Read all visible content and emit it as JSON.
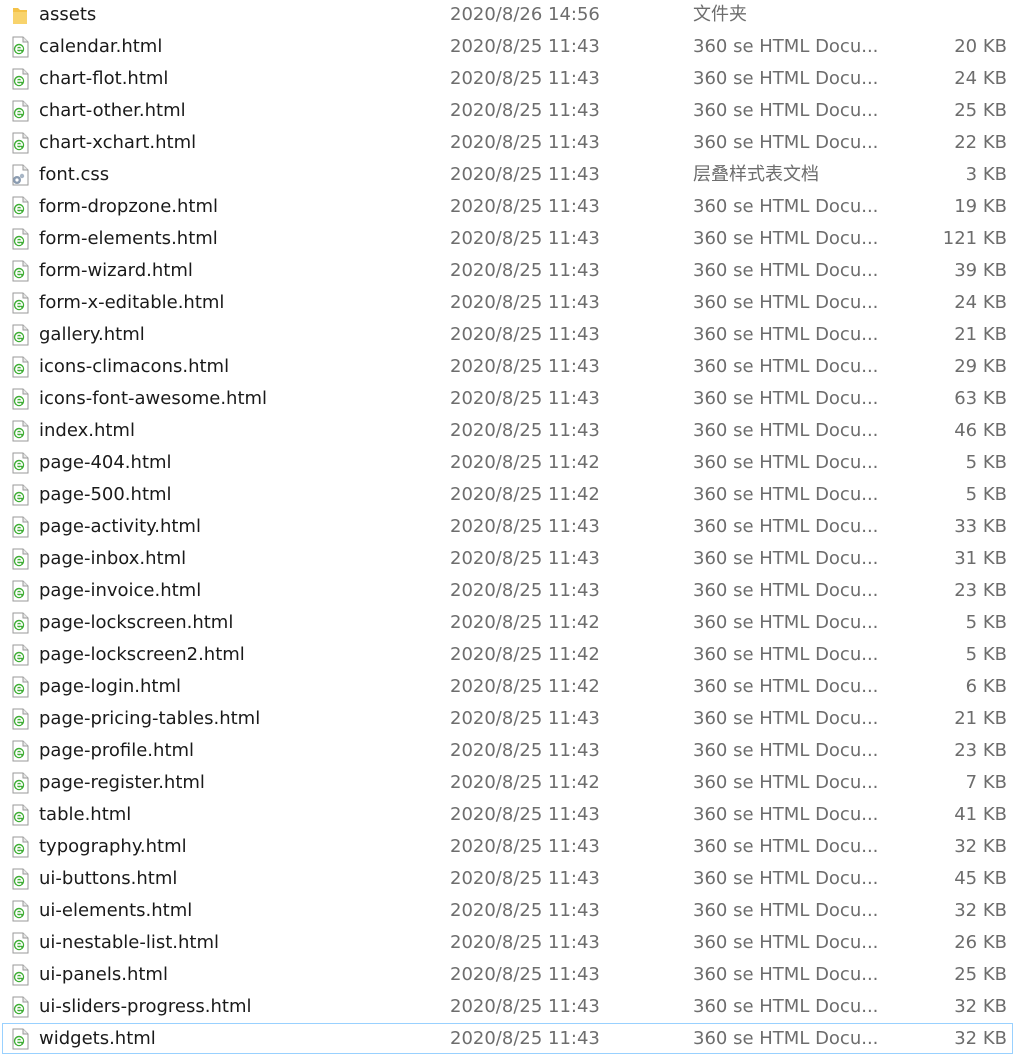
{
  "files": [
    {
      "name": "assets",
      "date": "2020/8/26 14:56",
      "type": "文件夹",
      "size": "",
      "icon": "folder-icon"
    },
    {
      "name": "calendar.html",
      "date": "2020/8/25 11:43",
      "type": "360 se HTML Docu...",
      "size": "20 KB",
      "icon": "html-file-icon"
    },
    {
      "name": "chart-flot.html",
      "date": "2020/8/25 11:43",
      "type": "360 se HTML Docu...",
      "size": "24 KB",
      "icon": "html-file-icon"
    },
    {
      "name": "chart-other.html",
      "date": "2020/8/25 11:43",
      "type": "360 se HTML Docu...",
      "size": "25 KB",
      "icon": "html-file-icon"
    },
    {
      "name": "chart-xchart.html",
      "date": "2020/8/25 11:43",
      "type": "360 se HTML Docu...",
      "size": "22 KB",
      "icon": "html-file-icon"
    },
    {
      "name": "font.css",
      "date": "2020/8/25 11:43",
      "type": "层叠样式表文档",
      "size": "3 KB",
      "icon": "css-file-icon"
    },
    {
      "name": "form-dropzone.html",
      "date": "2020/8/25 11:43",
      "type": "360 se HTML Docu...",
      "size": "19 KB",
      "icon": "html-file-icon"
    },
    {
      "name": "form-elements.html",
      "date": "2020/8/25 11:43",
      "type": "360 se HTML Docu...",
      "size": "121 KB",
      "icon": "html-file-icon"
    },
    {
      "name": "form-wizard.html",
      "date": "2020/8/25 11:43",
      "type": "360 se HTML Docu...",
      "size": "39 KB",
      "icon": "html-file-icon"
    },
    {
      "name": "form-x-editable.html",
      "date": "2020/8/25 11:43",
      "type": "360 se HTML Docu...",
      "size": "24 KB",
      "icon": "html-file-icon"
    },
    {
      "name": "gallery.html",
      "date": "2020/8/25 11:43",
      "type": "360 se HTML Docu...",
      "size": "21 KB",
      "icon": "html-file-icon"
    },
    {
      "name": "icons-climacons.html",
      "date": "2020/8/25 11:43",
      "type": "360 se HTML Docu...",
      "size": "29 KB",
      "icon": "html-file-icon"
    },
    {
      "name": "icons-font-awesome.html",
      "date": "2020/8/25 11:43",
      "type": "360 se HTML Docu...",
      "size": "63 KB",
      "icon": "html-file-icon"
    },
    {
      "name": "index.html",
      "date": "2020/8/25 11:43",
      "type": "360 se HTML Docu...",
      "size": "46 KB",
      "icon": "html-file-icon"
    },
    {
      "name": "page-404.html",
      "date": "2020/8/25 11:42",
      "type": "360 se HTML Docu...",
      "size": "5 KB",
      "icon": "html-file-icon"
    },
    {
      "name": "page-500.html",
      "date": "2020/8/25 11:42",
      "type": "360 se HTML Docu...",
      "size": "5 KB",
      "icon": "html-file-icon"
    },
    {
      "name": "page-activity.html",
      "date": "2020/8/25 11:43",
      "type": "360 se HTML Docu...",
      "size": "33 KB",
      "icon": "html-file-icon"
    },
    {
      "name": "page-inbox.html",
      "date": "2020/8/25 11:43",
      "type": "360 se HTML Docu...",
      "size": "31 KB",
      "icon": "html-file-icon"
    },
    {
      "name": "page-invoice.html",
      "date": "2020/8/25 11:43",
      "type": "360 se HTML Docu...",
      "size": "23 KB",
      "icon": "html-file-icon"
    },
    {
      "name": "page-lockscreen.html",
      "date": "2020/8/25 11:42",
      "type": "360 se HTML Docu...",
      "size": "5 KB",
      "icon": "html-file-icon"
    },
    {
      "name": "page-lockscreen2.html",
      "date": "2020/8/25 11:42",
      "type": "360 se HTML Docu...",
      "size": "5 KB",
      "icon": "html-file-icon"
    },
    {
      "name": "page-login.html",
      "date": "2020/8/25 11:42",
      "type": "360 se HTML Docu...",
      "size": "6 KB",
      "icon": "html-file-icon"
    },
    {
      "name": "page-pricing-tables.html",
      "date": "2020/8/25 11:43",
      "type": "360 se HTML Docu...",
      "size": "21 KB",
      "icon": "html-file-icon"
    },
    {
      "name": "page-profile.html",
      "date": "2020/8/25 11:43",
      "type": "360 se HTML Docu...",
      "size": "23 KB",
      "icon": "html-file-icon"
    },
    {
      "name": "page-register.html",
      "date": "2020/8/25 11:42",
      "type": "360 se HTML Docu...",
      "size": "7 KB",
      "icon": "html-file-icon"
    },
    {
      "name": "table.html",
      "date": "2020/8/25 11:43",
      "type": "360 se HTML Docu...",
      "size": "41 KB",
      "icon": "html-file-icon"
    },
    {
      "name": "typography.html",
      "date": "2020/8/25 11:43",
      "type": "360 se HTML Docu...",
      "size": "32 KB",
      "icon": "html-file-icon"
    },
    {
      "name": "ui-buttons.html",
      "date": "2020/8/25 11:43",
      "type": "360 se HTML Docu...",
      "size": "45 KB",
      "icon": "html-file-icon"
    },
    {
      "name": "ui-elements.html",
      "date": "2020/8/25 11:43",
      "type": "360 se HTML Docu...",
      "size": "32 KB",
      "icon": "html-file-icon"
    },
    {
      "name": "ui-nestable-list.html",
      "date": "2020/8/25 11:43",
      "type": "360 se HTML Docu...",
      "size": "26 KB",
      "icon": "html-file-icon"
    },
    {
      "name": "ui-panels.html",
      "date": "2020/8/25 11:43",
      "type": "360 se HTML Docu...",
      "size": "25 KB",
      "icon": "html-file-icon"
    },
    {
      "name": "ui-sliders-progress.html",
      "date": "2020/8/25 11:43",
      "type": "360 se HTML Docu...",
      "size": "32 KB",
      "icon": "html-file-icon"
    },
    {
      "name": "widgets.html",
      "date": "2020/8/25 11:43",
      "type": "360 se HTML Docu...",
      "size": "32 KB",
      "icon": "html-file-icon",
      "focused": true
    }
  ],
  "colors": {
    "name_text": "#1a1a1a",
    "meta_text": "#6d6d6d",
    "focus_border": "#99d1ff",
    "folder": "#f4c248",
    "html_icon_green": "#3fae35"
  }
}
